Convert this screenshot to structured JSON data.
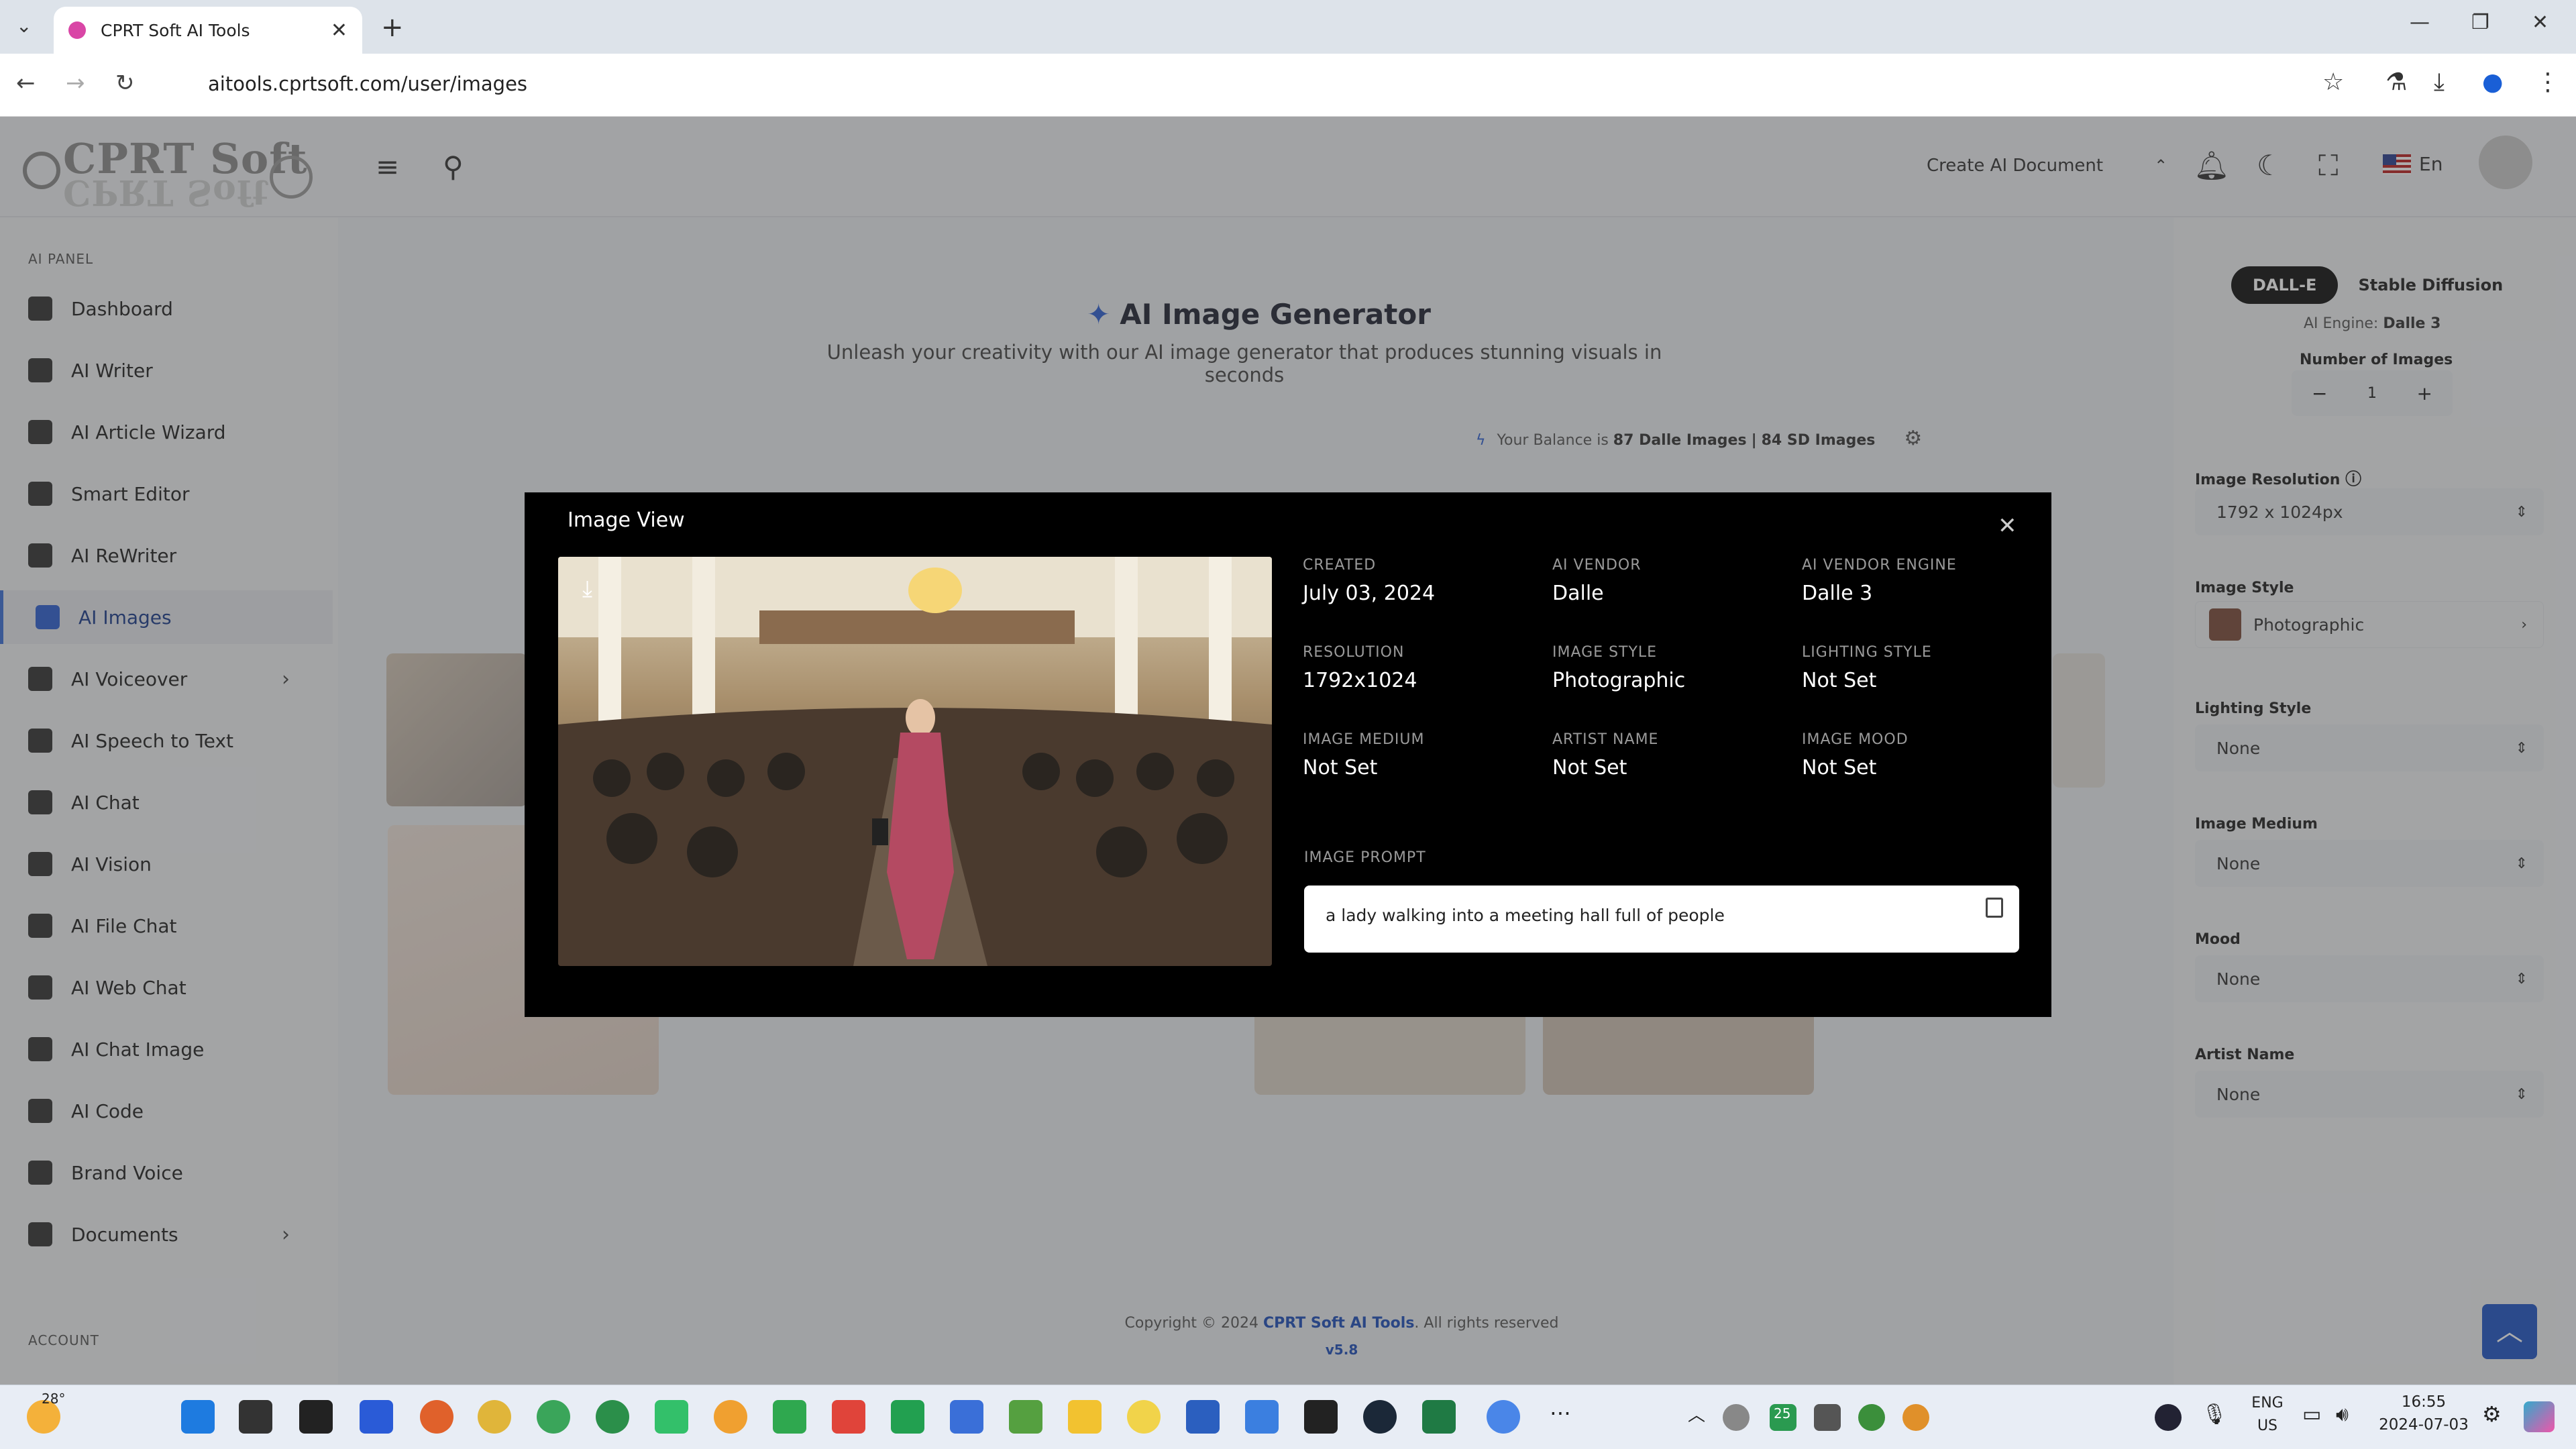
{
  "browser": {
    "tab_title": "CPRT Soft AI Tools",
    "url": "aitools.cprtsoft.com/user/images"
  },
  "logo": {
    "text": "CPRT Soft"
  },
  "topbar": {
    "create_label": "Create AI Document",
    "lang": "En"
  },
  "sidebar": {
    "section_ai": "AI PANEL",
    "items": [
      {
        "label": "Dashboard"
      },
      {
        "label": "AI Writer"
      },
      {
        "label": "AI Article Wizard"
      },
      {
        "label": "Smart Editor"
      },
      {
        "label": "AI ReWriter"
      },
      {
        "label": "AI Images"
      },
      {
        "label": "AI Voiceover"
      },
      {
        "label": "AI Speech to Text"
      },
      {
        "label": "AI Chat"
      },
      {
        "label": "AI Vision"
      },
      {
        "label": "AI File Chat"
      },
      {
        "label": "AI Web Chat"
      },
      {
        "label": "AI Chat Image"
      },
      {
        "label": "AI Code"
      },
      {
        "label": "Brand Voice"
      },
      {
        "label": "Documents"
      }
    ],
    "section_account": "ACCOUNT"
  },
  "main": {
    "title": "AI Image Generator",
    "subtitle": "Unleash your creativity with our AI image generator that produces stunning visuals in seconds",
    "balance_prefix": "Your Balance is",
    "balance_dalle": "87 Dalle Images",
    "balance_sep": "|",
    "balance_sd": "84 SD Images"
  },
  "right_panel": {
    "tab_active": "DALL-E",
    "tab_other": "Stable Diffusion",
    "engine_label": "AI Engine:",
    "engine_value": "Dalle 3",
    "num_images_label": "Number of Images",
    "num_images_value": "1",
    "resolution_label": "Image Resolution",
    "resolution_value": "1792 x 1024px",
    "style_label": "Image Style",
    "style_value": "Photographic",
    "lighting_label": "Lighting Style",
    "lighting_value": "None",
    "medium_label": "Image Medium",
    "medium_value": "None",
    "mood_label": "Mood",
    "mood_value": "None",
    "artist_label": "Artist Name",
    "artist_value": "None"
  },
  "footer": {
    "copyright": "Copyright © 2024",
    "brand": "CPRT Soft AI Tools",
    "rights": ". All rights reserved",
    "version": "v5.8"
  },
  "modal": {
    "title": "Image View",
    "fields": [
      {
        "key": "CREATED",
        "value": "July 03, 2024"
      },
      {
        "key": "AI VENDOR",
        "value": "Dalle"
      },
      {
        "key": "AI VENDOR ENGINE",
        "value": "Dalle 3"
      },
      {
        "key": "RESOLUTION",
        "value": "1792x1024"
      },
      {
        "key": "IMAGE STYLE",
        "value": "Photographic"
      },
      {
        "key": "LIGHTING STYLE",
        "value": "Not Set"
      },
      {
        "key": "IMAGE MEDIUM",
        "value": "Not Set"
      },
      {
        "key": "ARTIST NAME",
        "value": "Not Set"
      },
      {
        "key": "IMAGE MOOD",
        "value": "Not Set"
      }
    ],
    "prompt_label": "IMAGE PROMPT",
    "prompt": "a lady walking into a meeting hall full of people"
  },
  "taskbar": {
    "weather": "28°",
    "lang_top": "ENG",
    "lang_bottom": "US",
    "time": "16:55",
    "date": "2024-07-03",
    "badge": "25"
  },
  "colors": {
    "accent": "#1f55c4",
    "modal_bg": "#000000",
    "active_nav": "#2d5fd0"
  }
}
